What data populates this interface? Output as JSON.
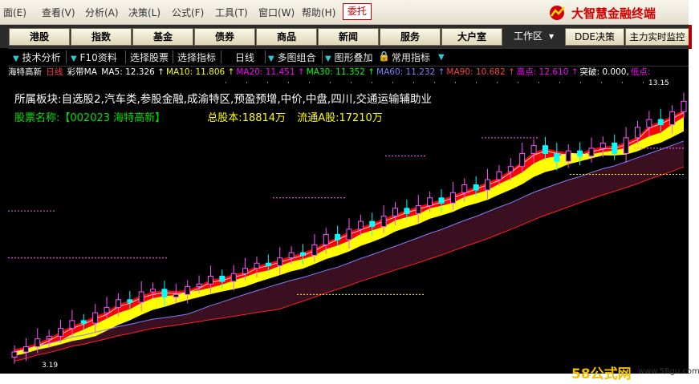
{
  "menu": {
    "items": [
      "面(E)",
      "查看(V)",
      "分析(A)",
      "决策(L)",
      "公式(F)",
      "工具(T)",
      "窗口(W)",
      "帮助(H)"
    ],
    "weituo": "委托",
    "brand": "大智慧金融终端"
  },
  "nav": {
    "buttons": [
      "港股",
      "指数",
      "基金",
      "债券",
      "商品",
      "新闻",
      "服务",
      "大户室"
    ],
    "workzone": "工作区",
    "dde": "DDE决策",
    "monitor": "主力实时监控"
  },
  "toolbar": {
    "items": [
      "技术分析",
      "F10资料",
      "选择股票",
      "选择指标",
      "日线",
      "多图组合",
      "图形叠加",
      "常用指标"
    ]
  },
  "indicator": {
    "stock": "海特高新",
    "period": "日线",
    "name": "彩带MA",
    "ma": [
      {
        "label": "MA5:",
        "value": "12.326",
        "arrow": "↑",
        "color": "#ffffff"
      },
      {
        "label": "MA10:",
        "value": "11.806",
        "arrow": "↑",
        "color": "#ffff00"
      },
      {
        "label": "MA20:",
        "value": "11.451",
        "arrow": "↑",
        "color": "#ff00ff"
      },
      {
        "label": "MA30:",
        "value": "11.352",
        "arrow": "↑",
        "color": "#00ff00"
      },
      {
        "label": "MA60:",
        "value": "11.232",
        "arrow": "↑",
        "color": "#8080ff"
      },
      {
        "label": "MA90:",
        "value": "10.682",
        "arrow": "↑",
        "color": "#ff4040"
      },
      {
        "label": "高点:",
        "value": "12.610",
        "arrow": "↑",
        "color": "#ff00ff"
      },
      {
        "label": "突破:",
        "value": "0.000,",
        "arrow": "",
        "color": "#ffffff"
      },
      {
        "label": "低点:",
        "value": "",
        "arrow": "",
        "color": "#ff00ff"
      }
    ]
  },
  "info": {
    "sector_label": "所属板块:",
    "sectors": "自选股2,汽车类,参股金融,成渝特区,预盈预增,中价,中盘,四川,交通运输辅助业",
    "name_label": "股票名称:",
    "code_name": "【002023 海特高新】",
    "total_label": "总股本:",
    "total_value": "18814万",
    "float_label": "流通A股:",
    "float_value": "17210万"
  },
  "colors": {
    "up": "#ff55ff",
    "down": "#00ffff",
    "band_red": "#ff0000",
    "band_yellow": "#ffff00",
    "band_dark": "#3a1020",
    "ma60": "#8080ff",
    "ma90": "#ff2020"
  },
  "chart_data": {
    "type": "candlestick",
    "price_labels": {
      "high": "13.15",
      "low": "3.19"
    },
    "close_series": [
      3.4,
      3.6,
      3.9,
      4.0,
      4.3,
      4.6,
      4.5,
      4.9,
      5.1,
      5.4,
      5.3,
      5.7,
      5.8,
      5.5,
      5.6,
      5.9,
      6.0,
      6.3,
      6.1,
      6.4,
      6.6,
      6.8,
      6.7,
      7.0,
      7.2,
      7.1,
      7.5,
      7.9,
      7.7,
      8.1,
      8.4,
      8.2,
      8.6,
      8.9,
      8.7,
      9.0,
      9.3,
      9.1,
      9.5,
      9.8,
      9.6,
      10.0,
      10.3,
      10.5,
      11.0,
      11.3,
      11.0,
      10.7,
      11.1,
      10.9,
      11.2,
      11.4,
      11.0,
      11.6,
      12.0,
      12.3,
      12.1,
      12.6,
      13.0
    ],
    "price_range": [
      3.0,
      13.5
    ]
  },
  "watermark": {
    "text": "58公式网",
    "url": "www.58gu.com"
  }
}
